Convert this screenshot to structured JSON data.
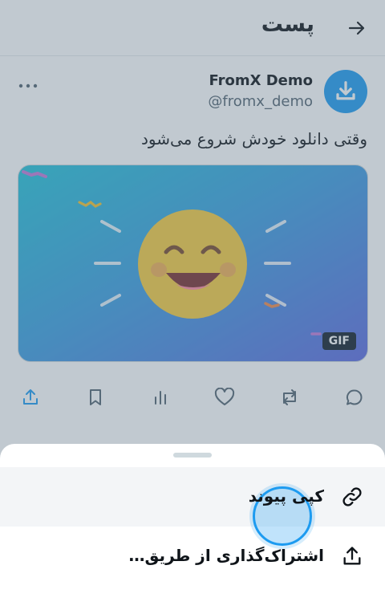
{
  "header": {
    "title": "پست"
  },
  "post": {
    "author_name": "FromX Demo",
    "author_handle": "@fromx_demo",
    "text": "وقتی دانلود خودش شروع می‌شود",
    "media_badge": "GIF"
  },
  "action_bar": {
    "icons": [
      "share-icon",
      "bookmark-icon",
      "views-chart-icon",
      "like-heart-icon",
      "repost-icon",
      "reply-icon"
    ]
  },
  "share_sheet": {
    "items": [
      {
        "label": "کپی پیوند",
        "icon": "link-icon"
      },
      {
        "label": "اشتراک‌گذاری از طریق…",
        "icon": "share-icon"
      }
    ]
  },
  "colors": {
    "accent": "#1d9bf0",
    "text": "#0f1419",
    "secondary_text": "#536471",
    "emoji_yellow": "#f5cb3f"
  }
}
